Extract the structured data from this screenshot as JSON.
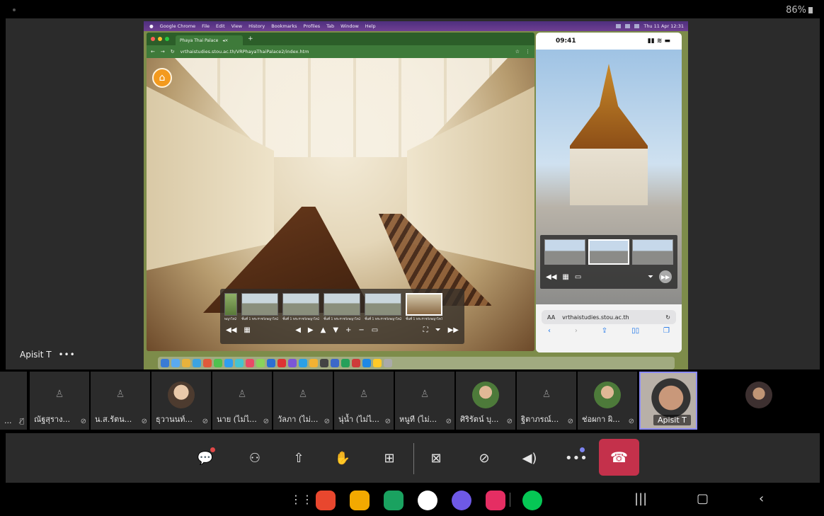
{
  "status": {
    "battery": "86%"
  },
  "stage": {
    "presenter": "Apisit T",
    "more": "•••"
  },
  "mac": {
    "menubar": [
      "Google Chrome",
      "File",
      "Edit",
      "View",
      "History",
      "Bookmarks",
      "Profiles",
      "Tab",
      "Window",
      "Help"
    ],
    "clock": "Thu 11 Apr 12:31",
    "tab_title": "Phaya Thai Palace",
    "url": "vrthaistudies.stou.ac.th/VRPhayaThaiPalace2/index.htm",
    "thumb_labels": [
      "พญาไท2",
      "ชั้นที่ 1 พระราชวังพญาไท2",
      "ชั้นที่ 1 พระราชวังพญาไท2",
      "ชั้นที่ 1 พระราชวังพญาไท2",
      "ชั้นที่ 1 พระราชวังพญาไท2",
      "ชั้นที่ 1 พระราชวังพญาไท7"
    ],
    "phone": {
      "time": "09:41",
      "text_size": "AA",
      "url": "vrthaistudies.stou.ac.th"
    }
  },
  "participants": [
    {
      "name": "...",
      "type": "placeholder"
    },
    {
      "name": "ณัฐสุราง...",
      "type": "placeholder"
    },
    {
      "name": "น.ส.รัตน...",
      "type": "placeholder"
    },
    {
      "name": "ธุวานนท์...",
      "type": "avatar"
    },
    {
      "name": "นาย (ไม่ไ...",
      "type": "placeholder"
    },
    {
      "name": "วัลภา (ไม่...",
      "type": "placeholder"
    },
    {
      "name": "นุ่น้ำ (ไม่ไ...",
      "type": "placeholder"
    },
    {
      "name": "หนูที (ไม่...",
      "type": "placeholder"
    },
    {
      "name": "ศิริรัตน์ บุ...",
      "type": "avatar"
    },
    {
      "name": "ฐิตาภรณ์...",
      "type": "placeholder"
    },
    {
      "name": "ช่อผกา ผิ...",
      "type": "avatar"
    }
  ],
  "self_view": {
    "name": "Apisit T"
  },
  "controls": [
    "chat-icon",
    "people-icon",
    "share-screen-icon",
    "raise-hand-icon",
    "view-grid-icon",
    "camera-off-icon",
    "mic-off-icon",
    "speaker-icon",
    "more-icon",
    "hang-up-icon"
  ],
  "colors": {
    "hangup": "#c4314b",
    "accent": "#8c8cf5"
  }
}
